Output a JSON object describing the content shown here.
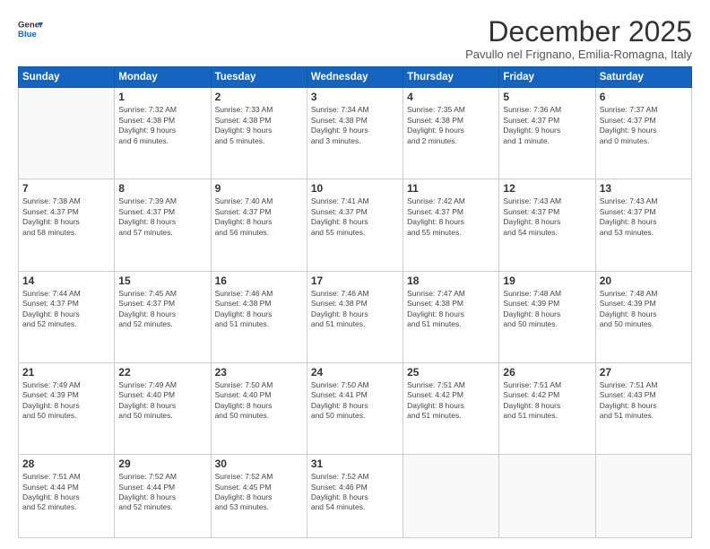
{
  "header": {
    "logo_line1": "General",
    "logo_line2": "Blue",
    "month_title": "December 2025",
    "subtitle": "Pavullo nel Frignano, Emilia-Romagna, Italy"
  },
  "weekdays": [
    "Sunday",
    "Monday",
    "Tuesday",
    "Wednesday",
    "Thursday",
    "Friday",
    "Saturday"
  ],
  "weeks": [
    [
      {
        "day": "",
        "info": ""
      },
      {
        "day": "1",
        "info": "Sunrise: 7:32 AM\nSunset: 4:38 PM\nDaylight: 9 hours\nand 6 minutes."
      },
      {
        "day": "2",
        "info": "Sunrise: 7:33 AM\nSunset: 4:38 PM\nDaylight: 9 hours\nand 5 minutes."
      },
      {
        "day": "3",
        "info": "Sunrise: 7:34 AM\nSunset: 4:38 PM\nDaylight: 9 hours\nand 3 minutes."
      },
      {
        "day": "4",
        "info": "Sunrise: 7:35 AM\nSunset: 4:38 PM\nDaylight: 9 hours\nand 2 minutes."
      },
      {
        "day": "5",
        "info": "Sunrise: 7:36 AM\nSunset: 4:37 PM\nDaylight: 9 hours\nand 1 minute."
      },
      {
        "day": "6",
        "info": "Sunrise: 7:37 AM\nSunset: 4:37 PM\nDaylight: 9 hours\nand 0 minutes."
      }
    ],
    [
      {
        "day": "7",
        "info": "Sunrise: 7:38 AM\nSunset: 4:37 PM\nDaylight: 8 hours\nand 58 minutes."
      },
      {
        "day": "8",
        "info": "Sunrise: 7:39 AM\nSunset: 4:37 PM\nDaylight: 8 hours\nand 57 minutes."
      },
      {
        "day": "9",
        "info": "Sunrise: 7:40 AM\nSunset: 4:37 PM\nDaylight: 8 hours\nand 56 minutes."
      },
      {
        "day": "10",
        "info": "Sunrise: 7:41 AM\nSunset: 4:37 PM\nDaylight: 8 hours\nand 55 minutes."
      },
      {
        "day": "11",
        "info": "Sunrise: 7:42 AM\nSunset: 4:37 PM\nDaylight: 8 hours\nand 55 minutes."
      },
      {
        "day": "12",
        "info": "Sunrise: 7:43 AM\nSunset: 4:37 PM\nDaylight: 8 hours\nand 54 minutes."
      },
      {
        "day": "13",
        "info": "Sunrise: 7:43 AM\nSunset: 4:37 PM\nDaylight: 8 hours\nand 53 minutes."
      }
    ],
    [
      {
        "day": "14",
        "info": "Sunrise: 7:44 AM\nSunset: 4:37 PM\nDaylight: 8 hours\nand 52 minutes."
      },
      {
        "day": "15",
        "info": "Sunrise: 7:45 AM\nSunset: 4:37 PM\nDaylight: 8 hours\nand 52 minutes."
      },
      {
        "day": "16",
        "info": "Sunrise: 7:46 AM\nSunset: 4:38 PM\nDaylight: 8 hours\nand 51 minutes."
      },
      {
        "day": "17",
        "info": "Sunrise: 7:46 AM\nSunset: 4:38 PM\nDaylight: 8 hours\nand 51 minutes."
      },
      {
        "day": "18",
        "info": "Sunrise: 7:47 AM\nSunset: 4:38 PM\nDaylight: 8 hours\nand 51 minutes."
      },
      {
        "day": "19",
        "info": "Sunrise: 7:48 AM\nSunset: 4:39 PM\nDaylight: 8 hours\nand 50 minutes."
      },
      {
        "day": "20",
        "info": "Sunrise: 7:48 AM\nSunset: 4:39 PM\nDaylight: 8 hours\nand 50 minutes."
      }
    ],
    [
      {
        "day": "21",
        "info": "Sunrise: 7:49 AM\nSunset: 4:39 PM\nDaylight: 8 hours\nand 50 minutes."
      },
      {
        "day": "22",
        "info": "Sunrise: 7:49 AM\nSunset: 4:40 PM\nDaylight: 8 hours\nand 50 minutes."
      },
      {
        "day": "23",
        "info": "Sunrise: 7:50 AM\nSunset: 4:40 PM\nDaylight: 8 hours\nand 50 minutes."
      },
      {
        "day": "24",
        "info": "Sunrise: 7:50 AM\nSunset: 4:41 PM\nDaylight: 8 hours\nand 50 minutes."
      },
      {
        "day": "25",
        "info": "Sunrise: 7:51 AM\nSunset: 4:42 PM\nDaylight: 8 hours\nand 51 minutes."
      },
      {
        "day": "26",
        "info": "Sunrise: 7:51 AM\nSunset: 4:42 PM\nDaylight: 8 hours\nand 51 minutes."
      },
      {
        "day": "27",
        "info": "Sunrise: 7:51 AM\nSunset: 4:43 PM\nDaylight: 8 hours\nand 51 minutes."
      }
    ],
    [
      {
        "day": "28",
        "info": "Sunrise: 7:51 AM\nSunset: 4:44 PM\nDaylight: 8 hours\nand 52 minutes."
      },
      {
        "day": "29",
        "info": "Sunrise: 7:52 AM\nSunset: 4:44 PM\nDaylight: 8 hours\nand 52 minutes."
      },
      {
        "day": "30",
        "info": "Sunrise: 7:52 AM\nSunset: 4:45 PM\nDaylight: 8 hours\nand 53 minutes."
      },
      {
        "day": "31",
        "info": "Sunrise: 7:52 AM\nSunset: 4:46 PM\nDaylight: 8 hours\nand 54 minutes."
      },
      {
        "day": "",
        "info": ""
      },
      {
        "day": "",
        "info": ""
      },
      {
        "day": "",
        "info": ""
      }
    ]
  ]
}
